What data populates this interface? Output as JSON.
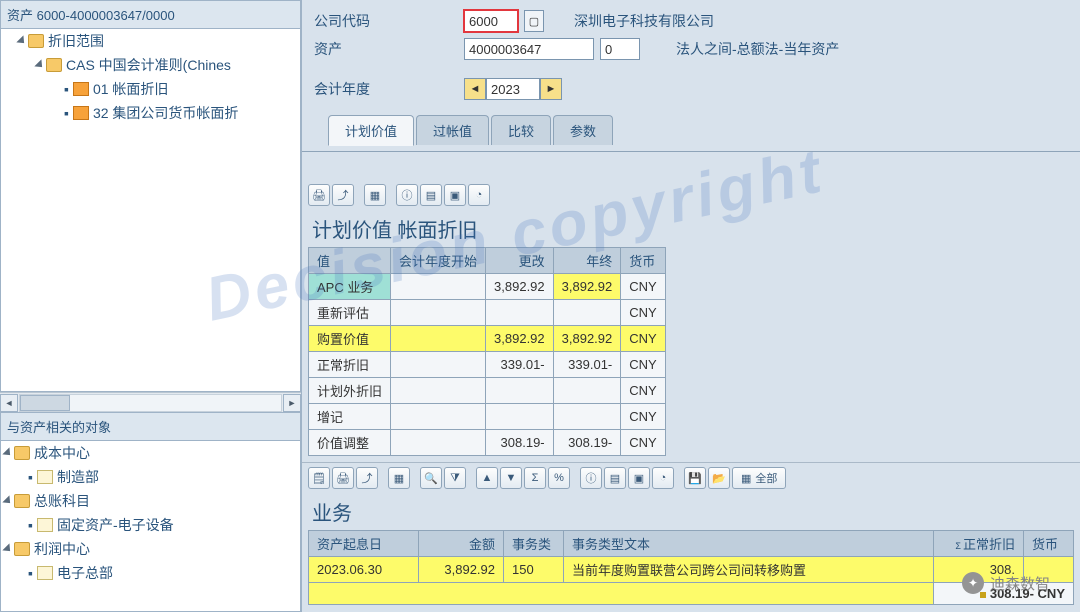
{
  "watermark_text": "Decision copyright",
  "wechat_stamp": "迪森数智",
  "tree_top": {
    "header": "资产 6000-4000003647/0000",
    "nodes": [
      {
        "indent": 1,
        "twisty": true,
        "icon": "folder",
        "label": "折旧范围"
      },
      {
        "indent": 2,
        "twisty": true,
        "icon": "folder",
        "label": "CAS 中国会计准则(Chines"
      },
      {
        "indent": 3,
        "twisty": false,
        "icon": "grid",
        "label": "01 帐面折旧"
      },
      {
        "indent": 3,
        "twisty": false,
        "icon": "grid",
        "label": "32 集团公司货币帐面折"
      }
    ]
  },
  "tree_bottom": {
    "header": "与资产相关的对象",
    "nodes": [
      {
        "indent": 0,
        "twisty": true,
        "icon": "folder",
        "label": "成本中心"
      },
      {
        "indent": 1,
        "twisty": false,
        "icon": "doc",
        "label": "制造部"
      },
      {
        "indent": 0,
        "twisty": true,
        "icon": "folder",
        "label": "总账科目"
      },
      {
        "indent": 1,
        "twisty": false,
        "icon": "doc",
        "label": "固定资产-电子设备"
      },
      {
        "indent": 0,
        "twisty": true,
        "icon": "folder",
        "label": "利润中心"
      },
      {
        "indent": 1,
        "twisty": false,
        "icon": "doc",
        "label": "电子总部"
      }
    ]
  },
  "header": {
    "company_code_label": "公司代码",
    "company_code": "6000",
    "company_name": "深圳电子科技有限公司",
    "asset_label": "资产",
    "asset_no": "4000003647",
    "asset_sub": "0",
    "asset_desc": "法人之间-总额法-当年资产",
    "fy_label": "会计年度",
    "fy": "2023"
  },
  "tabs": {
    "plan": "计划价值",
    "posted": "过帐值",
    "compare": "比较",
    "param": "参数"
  },
  "section1_title": "计划价值 帐面折旧",
  "plan_table": {
    "columns": [
      "值",
      "会计年度开始",
      "更改",
      "年终",
      "货币"
    ],
    "rows": [
      {
        "label": "APC 业务",
        "start": "",
        "change": "3,892.92",
        "end": "3,892.92",
        "cur": "CNY",
        "style": "teal"
      },
      {
        "label": "重新评估",
        "start": "",
        "change": "",
        "end": "",
        "cur": "CNY",
        "style": ""
      },
      {
        "label": "购置价值",
        "start": "",
        "change": "3,892.92",
        "end": "3,892.92",
        "cur": "CNY",
        "style": "yellow"
      },
      {
        "label": "正常折旧",
        "start": "",
        "change": "339.01-",
        "end": "339.01-",
        "cur": "CNY",
        "style": ""
      },
      {
        "label": "计划外折旧",
        "start": "",
        "change": "",
        "end": "",
        "cur": "CNY",
        "style": ""
      },
      {
        "label": "增记",
        "start": "",
        "change": "",
        "end": "",
        "cur": "CNY",
        "style": ""
      },
      {
        "label": "价值调整",
        "start": "",
        "change": "308.19-",
        "end": "308.19-",
        "cur": "CNY",
        "style": ""
      }
    ]
  },
  "section2_title": "业务",
  "biz_toolbar_all": "全部",
  "biz_table": {
    "columns": [
      "资产起息日",
      "金额",
      "事务类",
      "事务类型文本",
      "正常折旧",
      "货币"
    ],
    "rows": [
      {
        "date": "2023.06.30",
        "amount": "3,892.92",
        "ttype": "150",
        "ttext": "当前年度购置联营公司跨公司间转移购置",
        "dep": "308.",
        "cur": ""
      }
    ],
    "total": "308.19- CNY"
  }
}
